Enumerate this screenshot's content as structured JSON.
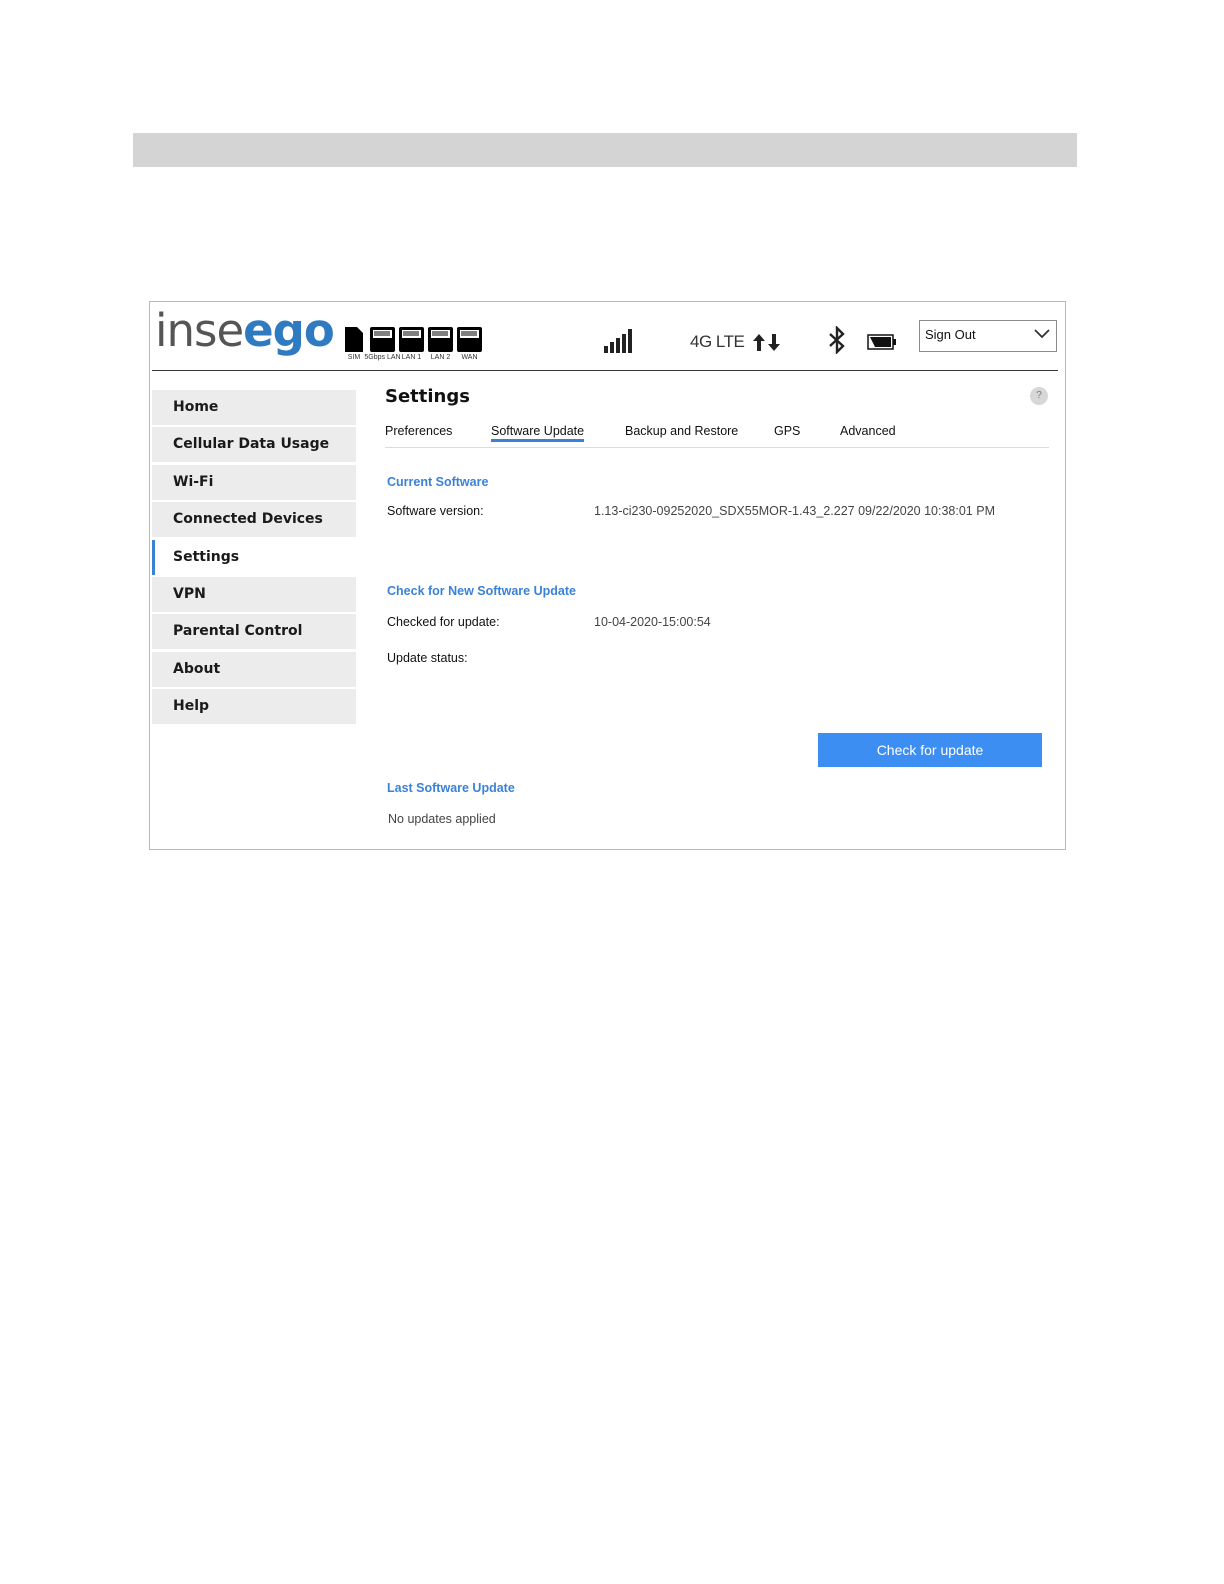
{
  "header": {
    "logo_part1": "inse",
    "logo_part2": "ego",
    "ports": [
      {
        "label": "SIM",
        "icon": "sim-card-icon"
      },
      {
        "label": "5Gbps LAN",
        "icon": "ethernet-port-icon"
      },
      {
        "label": "LAN 1",
        "icon": "ethernet-port-icon"
      },
      {
        "label": "LAN 2",
        "icon": "ethernet-port-icon"
      },
      {
        "label": "WAN",
        "icon": "ethernet-port-icon"
      }
    ],
    "signal_icon": "signal-bars-icon",
    "network_type": "4G LTE",
    "data_activity_icon": "up-down-arrows-icon",
    "bluetooth_icon": "bluetooth-icon",
    "battery_icon": "battery-icon",
    "signout_label": "Sign Out"
  },
  "sidebar": {
    "items": [
      {
        "label": "Home"
      },
      {
        "label": "Cellular Data Usage"
      },
      {
        "label": "Wi-Fi"
      },
      {
        "label": "Connected Devices"
      },
      {
        "label": "Settings",
        "active": true
      },
      {
        "label": "VPN"
      },
      {
        "label": "Parental Control"
      },
      {
        "label": "About"
      },
      {
        "label": "Help"
      }
    ]
  },
  "main": {
    "title": "Settings",
    "help_label": "?",
    "tabs": [
      {
        "label": "Preferences"
      },
      {
        "label": "Software Update",
        "active": true
      },
      {
        "label": "Backup and Restore"
      },
      {
        "label": "GPS"
      },
      {
        "label": "Advanced"
      }
    ],
    "current_software": {
      "title": "Current Software",
      "version_label": "Software version:",
      "version_value": "1.13-ci230-09252020_SDX55MOR-1.43_2.227 09/22/2020 10:38:01 PM"
    },
    "check_update": {
      "title": "Check for New Software Update",
      "checked_label": "Checked for update:",
      "checked_value": "10-04-2020-15:00:54",
      "status_label": "Update status:",
      "status_value": "",
      "button_label": "Check for update"
    },
    "last_update": {
      "title": "Last Software Update",
      "value": "No updates applied"
    }
  },
  "colors": {
    "accent": "#3b82d6",
    "button": "#3d8ef3",
    "logo_blue": "#2f7bc2",
    "topbar": "#d4d4d4"
  }
}
